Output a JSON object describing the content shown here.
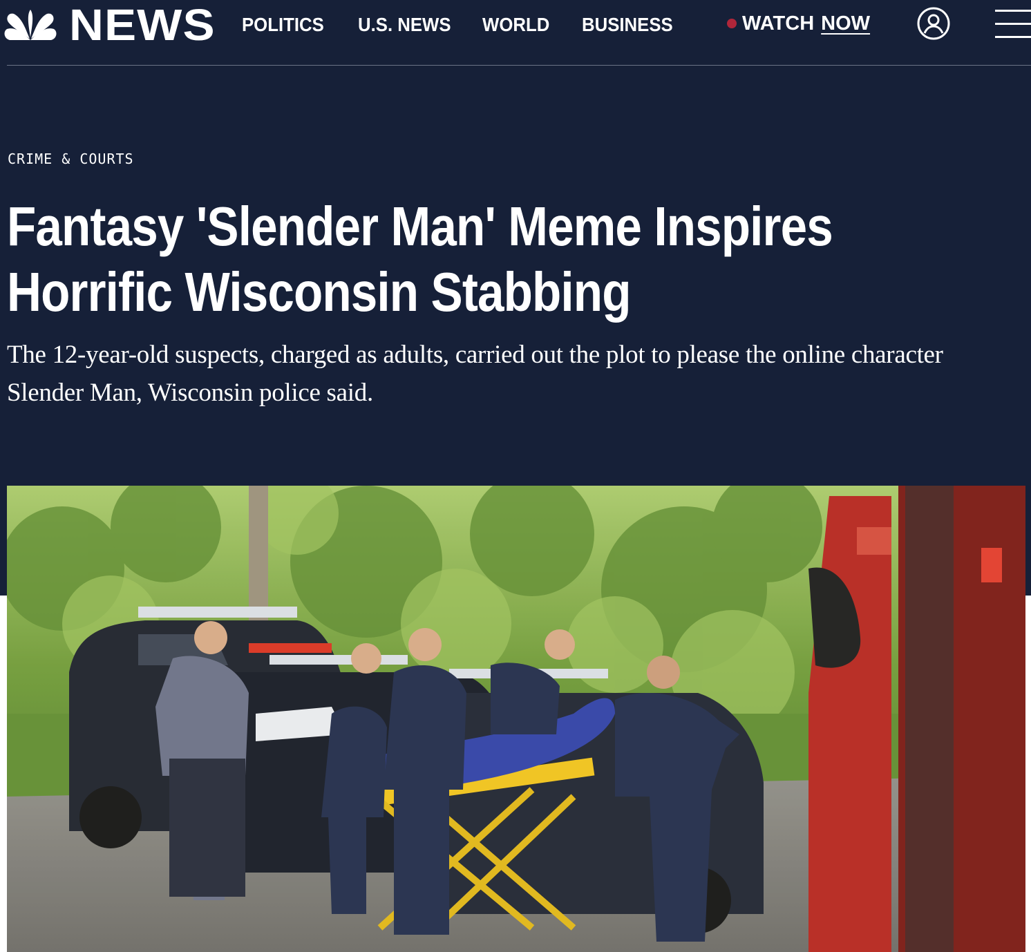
{
  "brand": {
    "wordmark": "NEWS",
    "logo_icon": "peacock-icon"
  },
  "nav": {
    "links": [
      "POLITICS",
      "U.S. NEWS",
      "WORLD",
      "BUSINESS"
    ],
    "watch_label": "WATCH",
    "watch_now": "NOW",
    "live_dot_color": "#b0263a",
    "account_icon": "user-icon",
    "menu_icon": "hamburger-icon"
  },
  "article": {
    "category": "CRIME & COURTS",
    "headline_line1": "Fantasy 'Slender Man' Meme Inspires",
    "headline_line2": "Horrific Wisconsin Stabbing",
    "dek": "The 12-year-old suspects, charged as adults, carried out the plot to please the online character Slender Man, Wisconsin police said."
  },
  "colors": {
    "hero_background": "#162038",
    "text": "#ffffff"
  }
}
